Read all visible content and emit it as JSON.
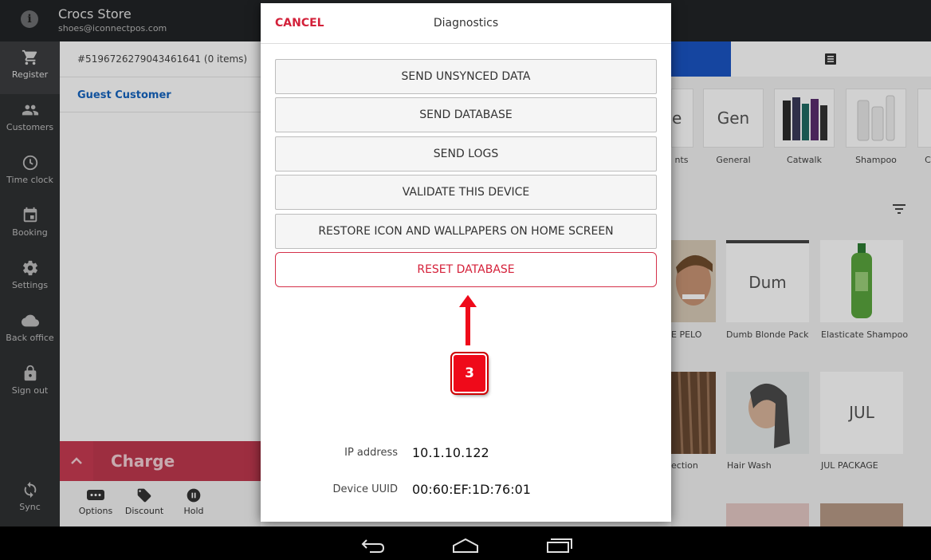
{
  "header": {
    "store_name": "Crocs Store",
    "store_email": "shoes@iconnectpos.com",
    "info_icon": "info-icon"
  },
  "sidebar": {
    "items": [
      {
        "label": "Register",
        "icon": "cart-icon"
      },
      {
        "label": "Customers",
        "icon": "people-icon"
      },
      {
        "label": "Time clock",
        "icon": "clock-icon"
      },
      {
        "label": "Booking",
        "icon": "calendar-icon"
      },
      {
        "label": "Settings",
        "icon": "gear-icon"
      },
      {
        "label": "Back office",
        "icon": "cloud-icon"
      },
      {
        "label": "Sign out",
        "icon": "lock-icon"
      }
    ],
    "sync_label": "Sync"
  },
  "order": {
    "id": "#5196726279043461641 (0 items)",
    "customer": "Guest Customer",
    "charge_label": "Charge",
    "actions": [
      {
        "label": "Options",
        "icon": "options-icon"
      },
      {
        "label": "Discount",
        "icon": "tag-icon"
      },
      {
        "label": "Hold",
        "icon": "pause-icon"
      }
    ]
  },
  "categories": [
    {
      "label": "nts",
      "tile": "e"
    },
    {
      "label": "General",
      "tile": "Gen"
    },
    {
      "label": "Catwalk",
      "tile": ""
    },
    {
      "label": "Shampoo",
      "tile": ""
    },
    {
      "label": "C",
      "tile": ""
    }
  ],
  "products": [
    {
      "label": "E PELO",
      "tile": ""
    },
    {
      "label": "Dumb Blonde Pack",
      "tile": "Dum"
    },
    {
      "label": "Elasticate Shampoo",
      "tile": ""
    },
    {
      "label": "ection",
      "tile": ""
    },
    {
      "label": "Hair Wash",
      "tile": ""
    },
    {
      "label": "JUL PACKAGE",
      "tile": "JUL"
    }
  ],
  "dialog": {
    "cancel_label": "CANCEL",
    "title": "Diagnostics",
    "buttons": [
      "SEND UNSYNCED DATA",
      "SEND DATABASE",
      "SEND LOGS",
      "VALIDATE THIS DEVICE",
      "RESTORE ICON AND WALLPAPERS ON HOME SCREEN"
    ],
    "reset_label": "RESET DATABASE",
    "ip_label": "IP address",
    "ip_value": "10.1.10.122",
    "uuid_label": "Device UUID",
    "uuid_value": "00:60:EF:1D:76:01"
  },
  "callout": {
    "step": "3",
    "color": "#ef0a1a"
  },
  "android_nav": {
    "icons": [
      "back-icon",
      "home-icon",
      "recents-icon"
    ]
  }
}
